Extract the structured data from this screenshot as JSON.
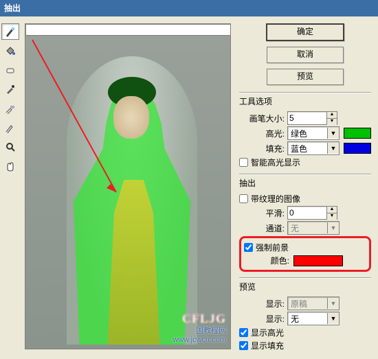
{
  "title": "抽出",
  "buttons": {
    "ok": "确定",
    "cancel": "取消",
    "preview": "预览"
  },
  "toolOptions": {
    "title": "工具选项",
    "brushSizeLabel": "画笔大小:",
    "brushSize": "5",
    "highlightLabel": "高光:",
    "highlight": "绿色",
    "fillLabel": "填充:",
    "fill": "蓝色",
    "smartHighlight": "智能高光显示"
  },
  "extract": {
    "title": "抽出",
    "textured": "带纹理的图像",
    "smoothLabel": "平滑:",
    "smooth": "0",
    "channelLabel": "通道:",
    "channel": "无",
    "forceFg": "强制前景",
    "colorLabel": "颜色:"
  },
  "preview": {
    "title": "预览",
    "showLabel": "显示:",
    "show": "原稿",
    "effectShowLabel": "显示:",
    "effectShow": "无",
    "showHighlight": "显示高光",
    "showFill": "显示填充"
  },
  "watermark": {
    "logo": "CFLJG",
    "line1": "国教程网",
    "line2": "www.jcwcn.com"
  }
}
